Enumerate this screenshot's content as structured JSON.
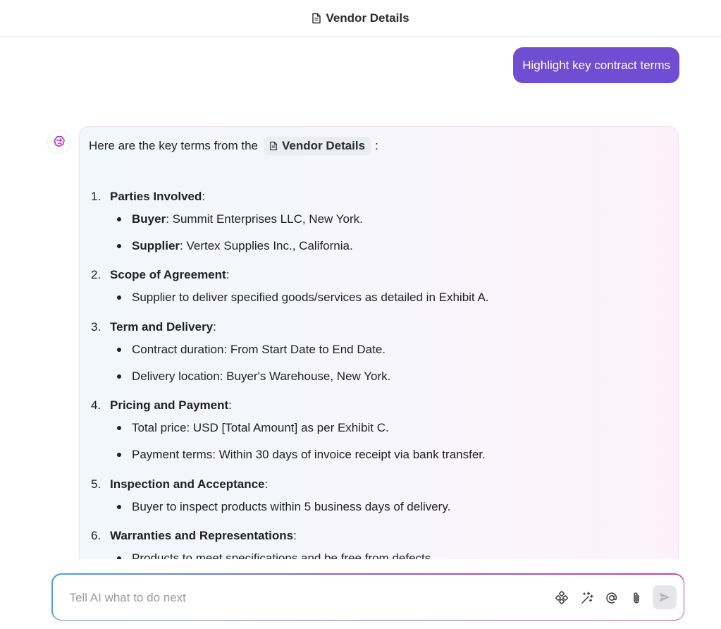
{
  "header": {
    "title": "Vendor Details",
    "icon": "document-icon"
  },
  "user_message": {
    "text": "Highlight key contract terms"
  },
  "ai_message": {
    "intro_prefix": "Here are the key terms from the",
    "doc_chip": "Vendor Details",
    "intro_suffix": ":",
    "items": [
      {
        "num": "1.",
        "title": "Parties Involved",
        "colon": ":",
        "bullets": [
          {
            "label": "Buyer",
            "text": ": Summit Enterprises LLC, New York."
          },
          {
            "label": "Supplier",
            "text": ": Vertex Supplies Inc., California."
          }
        ]
      },
      {
        "num": "2.",
        "title": "Scope of Agreement",
        "colon": ":",
        "bullets": [
          {
            "label": "",
            "text": "Supplier to deliver specified goods/services as detailed in Exhibit A."
          }
        ]
      },
      {
        "num": "3.",
        "title": "Term and Delivery",
        "colon": ":",
        "bullets": [
          {
            "label": "",
            "text": "Contract duration: From Start Date to End Date."
          },
          {
            "label": "",
            "text": "Delivery location: Buyer's Warehouse, New York."
          }
        ]
      },
      {
        "num": "4.",
        "title": "Pricing and Payment",
        "colon": ":",
        "bullets": [
          {
            "label": "",
            "text": "Total price: USD [Total Amount] as per Exhibit C."
          },
          {
            "label": "",
            "text": "Payment terms: Within 30 days of invoice receipt via bank transfer."
          }
        ]
      },
      {
        "num": "5.",
        "title": "Inspection and Acceptance",
        "colon": ":",
        "bullets": [
          {
            "label": "",
            "text": "Buyer to inspect products within 5 business days of delivery."
          }
        ]
      },
      {
        "num": "6.",
        "title": "Warranties and Representations",
        "colon": ":",
        "bullets": [
          {
            "label": "",
            "text": "Products to meet specifications and be free from defects."
          }
        ]
      }
    ]
  },
  "input": {
    "placeholder": "Tell AI what to do next",
    "value": ""
  },
  "toolbar_icons": [
    "integrations-icon",
    "magic-wand-icon",
    "mention-icon",
    "attach-icon",
    "send-icon"
  ],
  "colors": {
    "accent": "#6f4ed4",
    "gradient_start": "#47a4e0",
    "gradient_end": "#d63fa6"
  }
}
